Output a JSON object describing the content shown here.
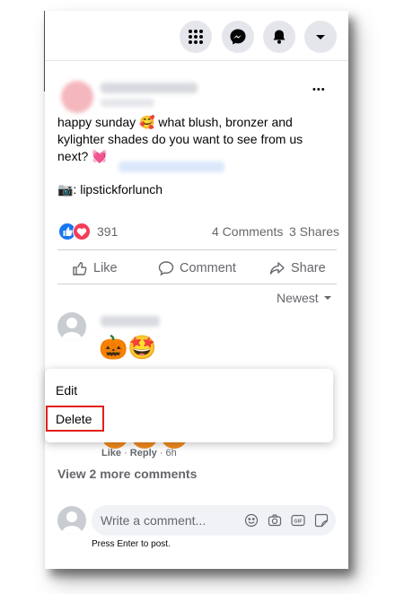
{
  "nav": {
    "icons": [
      "menu-grid-icon",
      "messenger-icon",
      "notifications-bell-icon",
      "account-dropdown-icon"
    ]
  },
  "post": {
    "text_line1": "happy sunday 🥰 what blush, bronzer and",
    "text_line2": "kylighter shades do you want to see from us",
    "text_line3": "next? 💓",
    "credit": "📷: lipstickforlunch",
    "more_label": "•••"
  },
  "stats": {
    "reactions_count": "391",
    "comments": "4 Comments",
    "shares": "3 Shares"
  },
  "actions": {
    "like": "Like",
    "comment": "Comment",
    "share": "Share"
  },
  "sort": {
    "label": "Newest"
  },
  "comment": {
    "emojis": "🎃🤩"
  },
  "menu": {
    "edit": "Edit",
    "delete": "Delete"
  },
  "reply_meta": {
    "like": "Like",
    "sep1": " · ",
    "reply": "Reply",
    "sep2": " · ",
    "time": "6h"
  },
  "more_comments": "View 2 more comments",
  "composer": {
    "placeholder": "Write a comment...",
    "hint": "Press Enter to post."
  },
  "colors": {
    "accent": "#1877f2",
    "highlight": "#e0201a",
    "muted": "#65676b"
  }
}
